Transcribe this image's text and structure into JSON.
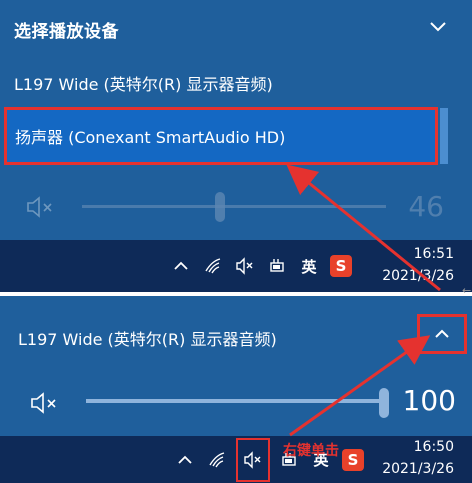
{
  "top_panel": {
    "header": "选择播放设备",
    "devices": [
      {
        "label": "L197 Wide (英特尔(R) 显示器音频)"
      },
      {
        "label": "扬声器 (Conexant SmartAudio HD)"
      }
    ],
    "volume": "46"
  },
  "taskbar_top": {
    "ime": "英",
    "sogou": "S",
    "time": "16:51",
    "date": "2021/3/26"
  },
  "bottom_panel": {
    "device_title": "L197 Wide (英特尔(R) 显示器音频)",
    "volume": "100"
  },
  "taskbar_bottom": {
    "ime": "英",
    "sogou": "S",
    "time": "16:50",
    "date": "2021/3/26"
  },
  "annotation": {
    "text": "右键单击"
  },
  "colors": {
    "panel": "#1f5f9c",
    "selected": "#1468c3",
    "taskbar": "#0e2a58",
    "highlight": "#e5322f"
  }
}
